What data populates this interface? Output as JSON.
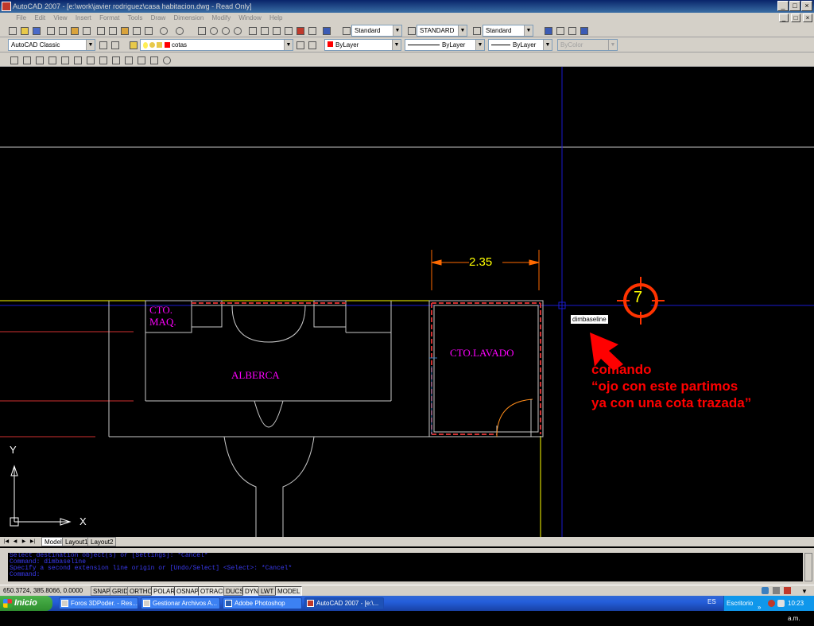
{
  "window": {
    "title": "AutoCAD 2007 - [e:\\work\\javier rodriguez\\casa habitacion.dwg - Read Only]",
    "controls": [
      "_",
      "□",
      "×"
    ]
  },
  "menu": [
    "File",
    "Edit",
    "View",
    "Insert",
    "Format",
    "Tools",
    "Draw",
    "Dimension",
    "Modify",
    "Window",
    "Help"
  ],
  "toolbars": {
    "text_style": "Standard",
    "dim_style": "STANDARD",
    "table_style": "Standard",
    "workspace": "AutoCAD Classic",
    "layer": "cotas",
    "color": "ByLayer",
    "linetype": "ByLayer",
    "lineweight": "ByLayer",
    "plotstyle": "ByColor"
  },
  "drawing": {
    "dimension_value": "2.35",
    "labels": {
      "cto_maq_line1": "CTO.",
      "cto_maq_line2": "MAQ.",
      "alberca": "ALBERCA",
      "cto_lavado": "CTO.LAVADO"
    },
    "tooltip": "dimbaseline",
    "callout_number": "7",
    "annotation": {
      "line1": "comando",
      "line2": "“ojo con este partimos",
      "line3": "ya con una cota trazada”"
    },
    "ucs": {
      "y": "Y",
      "x": "X"
    }
  },
  "tabs": [
    "Model",
    "Layout1",
    "Layout2"
  ],
  "command_lines": [
    "Select destination object(s) or [Settings]: *Cancel*",
    "Command: dimbaseline",
    "Specify a second extension line origin or [Undo/Select] <Select>: *Cancel*",
    "Command:"
  ],
  "status": {
    "coordinates": "650.3724, 385.8066, 0.0000",
    "toggles": [
      "SNAP",
      "GRID",
      "ORTHO",
      "POLAR",
      "OSNAP",
      "OTRACK",
      "DUCS",
      "DYN",
      "LWT",
      "MODEL"
    ],
    "active": [
      "POLAR",
      "OSNAP",
      "OTRACK",
      "DYN",
      "MODEL"
    ]
  },
  "taskbar": {
    "start": "Inicio",
    "tasks": [
      "Foros 3DPoder. - Res...",
      "Gestionar Archivos A...",
      "Adobe Photoshop",
      "AutoCAD 2007 - [e:\\..."
    ],
    "language": "ES",
    "desktop": "Escritorio",
    "clock": "10:23 a.m."
  },
  "colors": {
    "magenta": "#ff00ff",
    "yellow": "#ffff00",
    "red_annotation": "#ff0000",
    "dim_line": "#ff6a00",
    "crosshair": "#1a1acf"
  }
}
